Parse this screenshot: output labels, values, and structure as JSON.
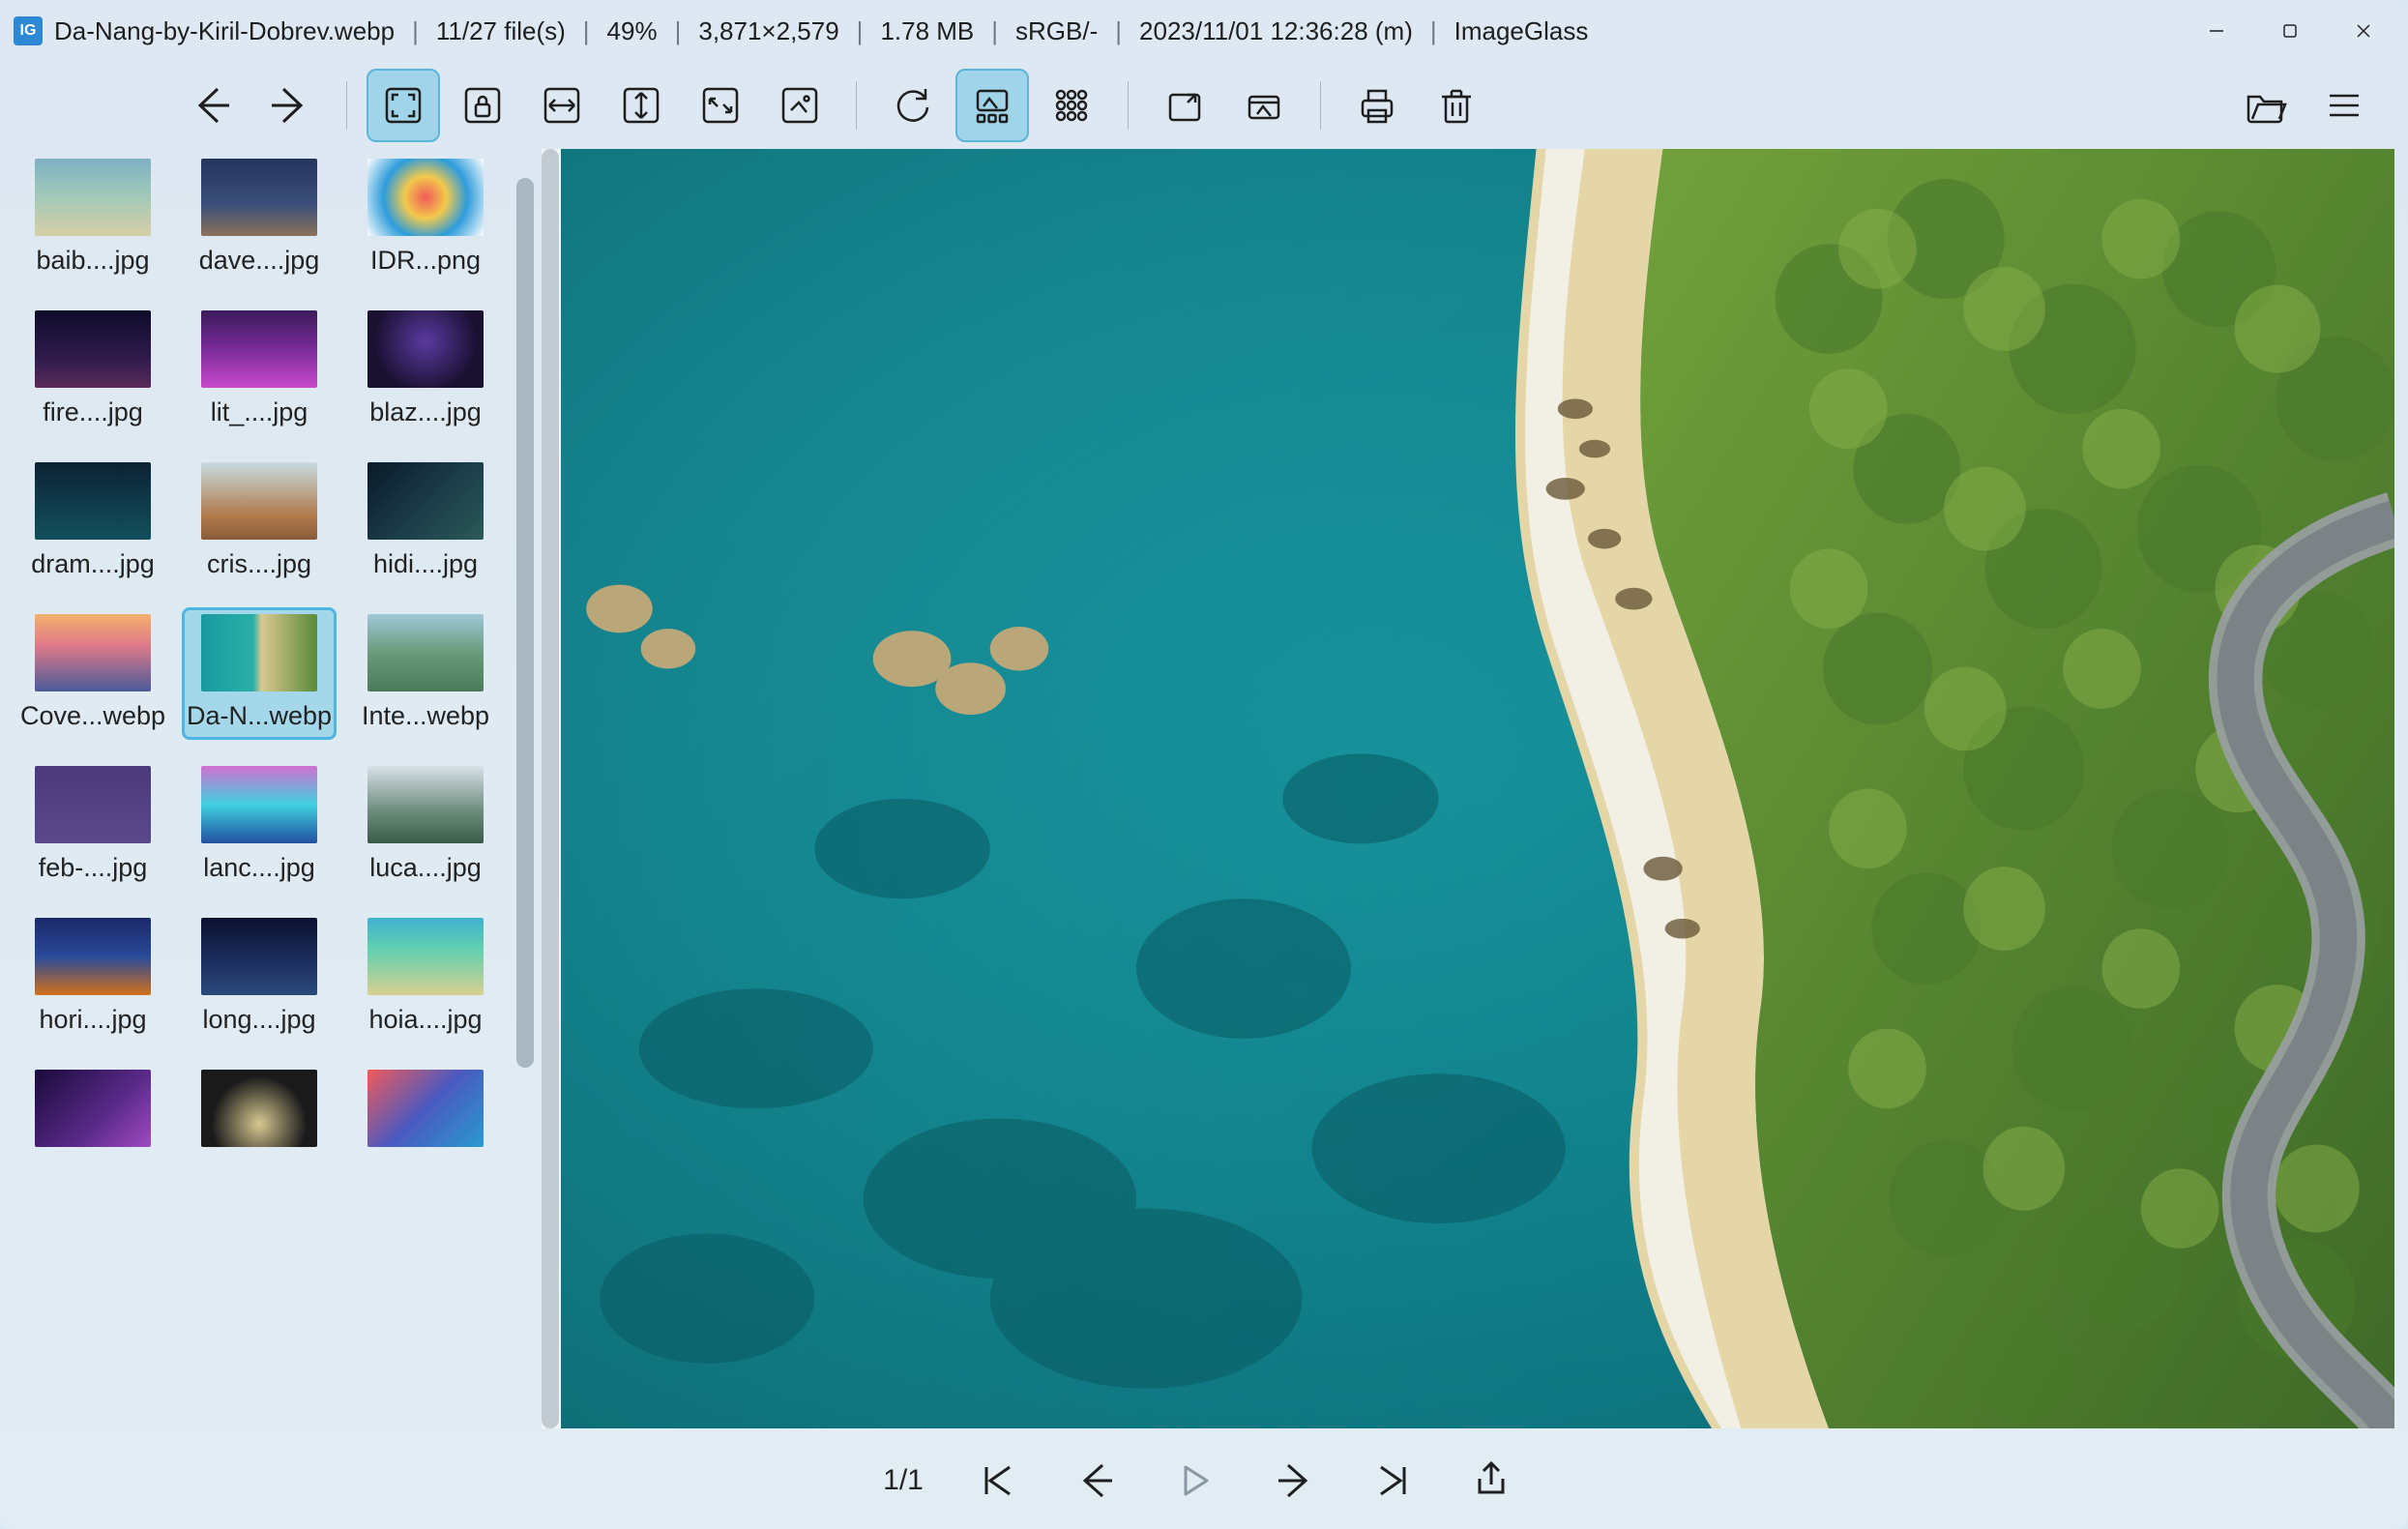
{
  "app": {
    "name": "ImageGlass",
    "icon_letters": "IG"
  },
  "titlebar": {
    "filename": "Da-Nang-by-Kiril-Dobrev.webp",
    "file_index": "11/27 file(s)",
    "zoom": "49%",
    "dimensions": "3,871×2,579",
    "filesize": "1.78 MB",
    "colorspace": "sRGB/-",
    "datetime": "2023/11/01 12:36:28 (m)"
  },
  "footer": {
    "frames": "1/1"
  },
  "thumbnails": [
    {
      "label": "baib....jpg",
      "bg": "linear-gradient(180deg,#7eb1c3 0%,#a2c9b8 50%,#d7cfa6 100%)",
      "selected": false
    },
    {
      "label": "dave....jpg",
      "bg": "linear-gradient(180deg,#24355e 0%,#3b4f7a 60%,#8b6f5b 100%)",
      "selected": false
    },
    {
      "label": "IDR...png",
      "bg": "radial-gradient(circle,#f25a5a 0%,#f2c94c 30%,#2d9cdb 60%,#ffffff 100%)",
      "selected": false
    },
    {
      "label": "fire....jpg",
      "bg": "linear-gradient(180deg,#0d0b2a 0%,#2e1a4a 60%,#5a2a5a 100%)",
      "selected": false
    },
    {
      "label": "lit_....jpg",
      "bg": "linear-gradient(180deg,#3b1a5a 0%,#7a2a9a 50%,#c94acb 100%)",
      "selected": false
    },
    {
      "label": "blaz....jpg",
      "bg": "radial-gradient(circle at 50% 40%,#5a3aa0 0%,#1a1030 70%)",
      "selected": false
    },
    {
      "label": "dram....jpg",
      "bg": "linear-gradient(180deg,#0a2232 0%,#0e3a4a 50%,#13505b 100%)",
      "selected": false
    },
    {
      "label": "cris....jpg",
      "bg": "linear-gradient(180deg,#c8dbe0 0%,#b07a4a 70%,#8a5a3a 100%)",
      "selected": false
    },
    {
      "label": "hidi....jpg",
      "bg": "linear-gradient(135deg,#0a1a28 0%,#1a3a48 50%,#2a5a58 100%)",
      "selected": false
    },
    {
      "label": "Cove...webp",
      "bg": "linear-gradient(180deg,#f2b06a 0%,#e07a8a 40%,#4a5a9a 100%)",
      "selected": false
    },
    {
      "label": "Da-N...webp",
      "bg": "linear-gradient(90deg,#1a9aa0 0%,#2ab0a8 45%,#d8c890 52%,#5a8a3a 100%)",
      "selected": true
    },
    {
      "label": "Inte...webp",
      "bg": "linear-gradient(180deg,#a0c8d8 0%,#6a9a7a 50%,#4a7a5a 100%)",
      "selected": false
    },
    {
      "label": "feb-....jpg",
      "bg": "linear-gradient(180deg,#4a3a7a 0%,#5a4a8a 100%)",
      "selected": false
    },
    {
      "label": "lanc....jpg",
      "bg": "linear-gradient(180deg,#d070d0 0%,#40d0e0 50%,#2050a0 100%)",
      "selected": false
    },
    {
      "label": "luca....jpg",
      "bg": "linear-gradient(180deg,#d8e0e8 0%,#6a8a7a 60%,#3a5a4a 100%)",
      "selected": false
    },
    {
      "label": "hori....jpg",
      "bg": "linear-gradient(180deg,#1a2a6a 0%,#2a4a9a 50%,#d0701a 100%)",
      "selected": false
    },
    {
      "label": "long....jpg",
      "bg": "linear-gradient(180deg,#0a1030 0%,#1a2a5a 50%,#2a4a7a 100%)",
      "selected": false
    },
    {
      "label": "hoia....jpg",
      "bg": "linear-gradient(180deg,#40b0d0 0%,#60d0b0 40%,#d8d090 100%)",
      "selected": false
    },
    {
      "label": "",
      "bg": "linear-gradient(135deg,#1a0a3a 0%,#5a2a8a 60%,#a04ac0 100%)",
      "selected": false
    },
    {
      "label": "",
      "bg": "radial-gradient(circle at 50% 70%,#d8c890 0%,#1a1a1a 60%)",
      "selected": false
    },
    {
      "label": "",
      "bg": "linear-gradient(135deg,#f05a5a 0%,#4a5ac0 50%,#2a9ad0 100%)",
      "selected": false
    }
  ]
}
